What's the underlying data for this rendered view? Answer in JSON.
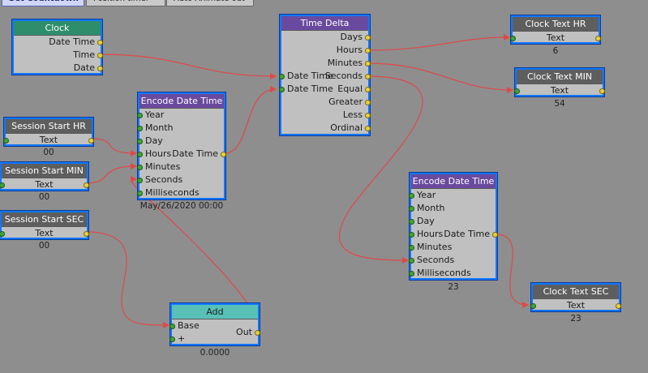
{
  "tabs": [
    {
      "label": "Set Countdown",
      "active": true
    },
    {
      "label": "Position timer",
      "active": false
    },
    {
      "label": "Auto Animate out",
      "active": false
    }
  ],
  "nodes": {
    "clock": {
      "title": "Clock",
      "outputs": [
        "Date Time",
        "Time",
        "Date"
      ]
    },
    "time_delta": {
      "title": "Time Delta",
      "inputs": [
        "Date Time",
        "Date Time"
      ],
      "outputs": [
        "Days",
        "Hours",
        "Minutes",
        "Seconds",
        "Equal",
        "Greater",
        "Less",
        "Ordinal"
      ]
    },
    "encode1": {
      "title": "Encode Date Time",
      "inputs": [
        "Year",
        "Month",
        "Day",
        "Hours",
        "Minutes",
        "Seconds",
        "Milliseconds"
      ],
      "output": "Date Time",
      "caption": "May/26/2020 00:00"
    },
    "encode2": {
      "title": "Encode Date Time",
      "inputs": [
        "Year",
        "Month",
        "Day",
        "Hours",
        "Minutes",
        "Seconds",
        "Milliseconds"
      ],
      "output": "Date Time",
      "caption": "23"
    },
    "session_hr": {
      "title": "Session Start HR",
      "port": "Text",
      "caption": "00"
    },
    "session_min": {
      "title": "Session Start MIN",
      "port": "Text",
      "caption": "00"
    },
    "session_sec": {
      "title": "Session Start SEC",
      "port": "Text",
      "caption": "00"
    },
    "clock_hr": {
      "title": "Clock Text HR",
      "port": "Text",
      "caption": "6"
    },
    "clock_min": {
      "title": "Clock Text MIN",
      "port": "Text",
      "caption": "54"
    },
    "clock_sec": {
      "title": "Clock Text SEC",
      "port": "Text",
      "caption": "23"
    },
    "add": {
      "title": "Add",
      "inputs": [
        "Base",
        "+"
      ],
      "output": "Out",
      "caption": "0.0000"
    }
  },
  "colors": {
    "background": "#8e8e8e",
    "node_border": "#1177ff",
    "wire": "#e0484a"
  }
}
